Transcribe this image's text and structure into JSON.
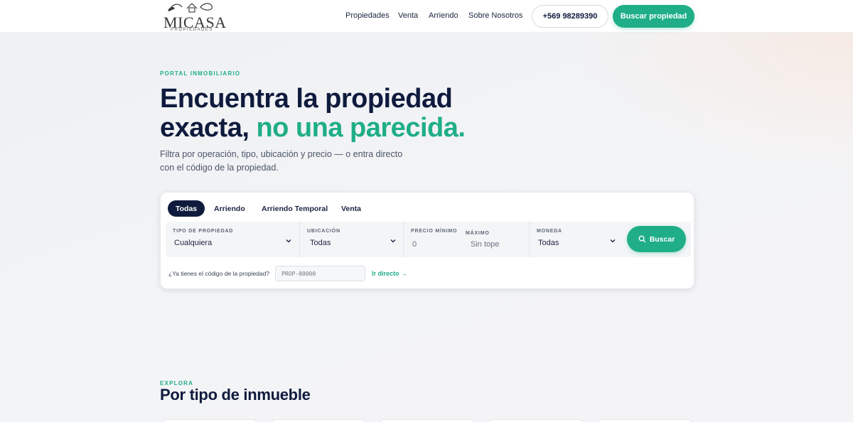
{
  "header": {
    "logo": {
      "word": "MICASA",
      "sub": "PROPIEDADES"
    },
    "nav": [
      "Propiedades",
      "Venta",
      "Arriendo",
      "Sobre Nosotros"
    ],
    "phone": "+569 98289390",
    "cta": "Buscar propiedad"
  },
  "hero": {
    "eyebrow": "PORTAL INMOBILIARIO",
    "title_line1": "Encuentra la propiedad",
    "title_line2_plain": "exacta, ",
    "title_line2_accent": "no una parecida.",
    "subtitle": "Filtra por operación, tipo, ubicación y precio — o entra directo con el código de la propiedad."
  },
  "search": {
    "tabs": [
      "Todas",
      "Arriendo",
      "Arriendo Temporal",
      "Venta"
    ],
    "active_tab": "Todas",
    "fields": {
      "tipo": {
        "label": "TIPO DE PROPIEDAD",
        "value": "Cualquiera"
      },
      "ubicacion": {
        "label": "UBICACIÓN",
        "value": "Todas"
      },
      "precio_min": {
        "label": "PRECIO MÍNIMO",
        "placeholder": "0"
      },
      "precio_max": {
        "label": "MÁXIMO",
        "placeholder": "Sin tope"
      },
      "moneda": {
        "label": "MONEDA",
        "value": "Todas"
      }
    },
    "button": "Buscar",
    "code_question": "¿Ya tienes el código de la propiedad?",
    "code_placeholder": "PROP-00000",
    "code_link": "Ir directo →"
  },
  "explore": {
    "eyebrow": "EXPLORA",
    "title": "Por tipo de inmueble"
  },
  "colors": {
    "navy": "#0f1b3d",
    "accent": "#1fae88",
    "background": "#f3f4f6"
  },
  "icons": [
    "logo-leaf-house-icon",
    "chevron-down-icon",
    "search-icon"
  ]
}
